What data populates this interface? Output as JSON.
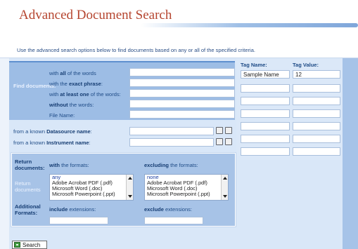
{
  "header": {
    "title": "Advanced Document Search",
    "intro": "Use the advanced search options below to find documents based on any or all of the specified criteria."
  },
  "find": {
    "group_label": "Find documents:",
    "rows": [
      {
        "pre": "with ",
        "bold": "all",
        "post": " of the words",
        "value": ""
      },
      {
        "pre": "with the ",
        "bold": "exact phrase",
        "post": ":",
        "value": ""
      },
      {
        "pre": "with ",
        "bold": "at least one",
        "post": " of the words:",
        "value": ""
      },
      {
        "pre": "",
        "bold": "without",
        "post": " the words:",
        "value": ""
      },
      {
        "pre": "",
        "bold": "",
        "post": "File Name:",
        "value": ""
      }
    ],
    "datasource": {
      "pre": "from a known ",
      "bold": "Datasource name",
      "post": ":",
      "value": ""
    },
    "instrument": {
      "pre": "from a known ",
      "bold": "Instrument name",
      "post": ":",
      "value": ""
    }
  },
  "tags": {
    "name_header": "Tag Name:",
    "value_header": "Tag Value:",
    "rows": [
      {
        "name": "Sample Name",
        "value": "12"
      },
      {
        "name": "",
        "value": ""
      },
      {
        "name": "",
        "value": ""
      },
      {
        "name": "",
        "value": ""
      },
      {
        "name": "",
        "value": ""
      },
      {
        "name": "",
        "value": ""
      },
      {
        "name": "",
        "value": ""
      }
    ]
  },
  "return": {
    "label": "Return documents:",
    "with_formats": {
      "pre": "with ",
      "post": "the formats:"
    },
    "excluding_formats": {
      "pre": "excluding ",
      "post": "the formats:"
    },
    "side_label": "Return documents",
    "include_list": [
      "any",
      "Adobe Acrobat PDF (.pdf)",
      "Microsoft Word (.doc)",
      "Microsoft Powerpoint (.ppt)"
    ],
    "exclude_list": [
      "none",
      "Adobe Acrobat PDF (.pdf)",
      "Microsoft Word (.doc)",
      "Microsoft Powerpoint (.ppt)"
    ],
    "additional_label": "Additional Formats:",
    "include_ext": {
      "pre": "include ",
      "post": "extensions:"
    },
    "exclude_ext": {
      "pre": "exclude ",
      "post": "extensions:"
    }
  },
  "search_button": "Search"
}
